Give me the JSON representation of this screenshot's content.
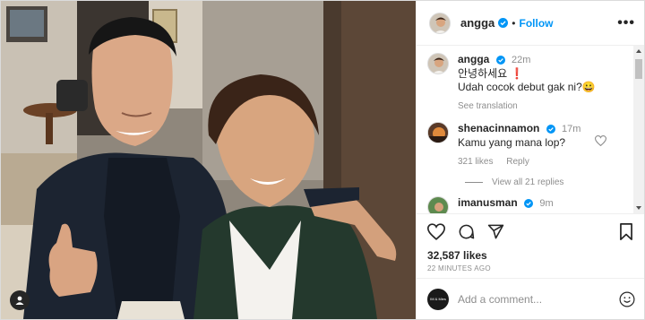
{
  "post": {
    "author": "angga",
    "follow_label": "Follow",
    "more_label": "•••",
    "caption_time": "22m",
    "caption_line1": "안녕하세요 ❗",
    "caption_line2": "Udah cocok debut gak ni?😀",
    "see_translation": "See translation",
    "likes": "32,587 likes",
    "time_ago": "22 MINUTES AGO",
    "add_comment_placeholder": "Add a comment...",
    "commenter_badge": "IM & Mies"
  },
  "comments": [
    {
      "user": "shenacinnamon",
      "time": "17m",
      "text": "Kamu yang mana lop?",
      "likes": "321 likes",
      "reply": "Reply",
      "view_replies": "View all 21 replies"
    },
    {
      "user": "imanusman",
      "time": "9m"
    }
  ],
  "colors": {
    "accent": "#0095f6",
    "verified": "#0095f6",
    "text": "#262626",
    "muted": "#8e8e8e"
  }
}
